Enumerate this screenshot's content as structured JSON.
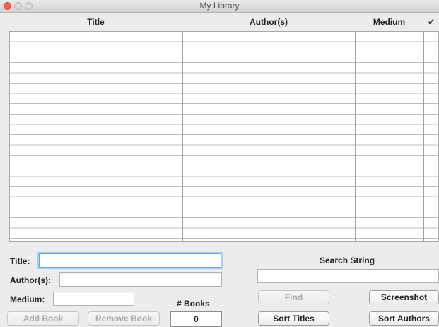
{
  "window": {
    "title": "My Library"
  },
  "table": {
    "columns": [
      "Title",
      "Author(s)",
      "Medium",
      "✔"
    ]
  },
  "form": {
    "title_label": "Title:",
    "title_value": "",
    "authors_label": "Author(s):",
    "authors_value": "",
    "medium_label": "Medium:",
    "medium_value": "",
    "add_book_label": "Add Book",
    "remove_book_label": "Remove Book",
    "books_count_label": "# Books",
    "books_count_value": "0"
  },
  "search": {
    "label": "Search String",
    "value": "",
    "find_label": "Find",
    "screenshot_label": "Screenshot",
    "sort_titles_label": "Sort Titles",
    "sort_authors_label": "Sort Authors"
  }
}
